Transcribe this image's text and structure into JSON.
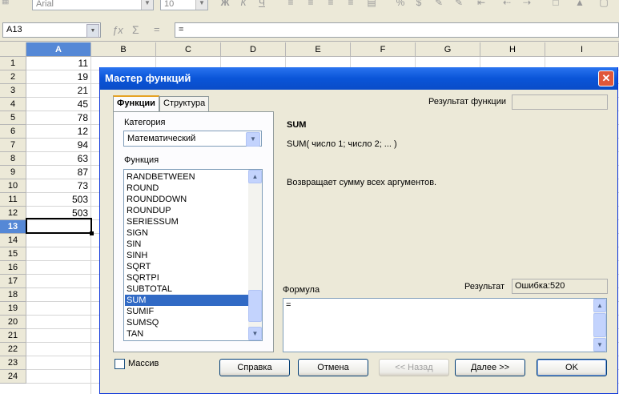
{
  "toolbar": {
    "font_name": "Arial",
    "font_size": "10",
    "icons": [
      "bold-icon",
      "italic-icon",
      "underline-icon",
      "align-left-icon",
      "align-center-icon",
      "align-right-icon",
      "justify-icon",
      "merge-icon",
      "percent-icon",
      "currency-icon",
      "decimal-add-icon",
      "decimal-remove-icon",
      "indent-decrease-icon",
      "indent-increase-icon",
      "borders-icon",
      "fill-color-icon",
      "font-color-icon"
    ]
  },
  "formula_bar": {
    "cell_ref": "A13",
    "content": "="
  },
  "sheet": {
    "columns": [
      "A",
      "B",
      "C",
      "D",
      "E",
      "F",
      "G",
      "H",
      "I"
    ],
    "rows": [
      "1",
      "2",
      "3",
      "4",
      "5",
      "6",
      "7",
      "8",
      "9",
      "10",
      "11",
      "12",
      "13",
      "14",
      "15",
      "16",
      "17",
      "18",
      "19",
      "20",
      "21",
      "22",
      "23",
      "24"
    ],
    "col_a_values": [
      "11",
      "19",
      "21",
      "45",
      "78",
      "12",
      "94",
      "63",
      "87",
      "73",
      "503",
      "503"
    ]
  },
  "dialog": {
    "title": "Мастер функций",
    "tabs": [
      "Функции",
      "Структура"
    ],
    "category_label": "Категория",
    "category_value": "Математический",
    "function_label": "Функция",
    "functions": [
      "RANDBETWEEN",
      "ROUND",
      "ROUNDDOWN",
      "ROUNDUP",
      "SERIESSUM",
      "SIGN",
      "SIN",
      "SINH",
      "SQRT",
      "SQRTPI",
      "SUBTOTAL",
      "SUM",
      "SUMIF",
      "SUMSQ",
      "TAN"
    ],
    "selected_function": "SUM",
    "function_result_label": "Результат функции",
    "function_result_value": "",
    "func_name": "SUM",
    "func_syntax": "SUM( число 1; число 2; ... )",
    "func_description": "Возвращает сумму всех аргументов.",
    "formula_label": "Формула",
    "formula_value": "=",
    "result_label": "Результат",
    "result_value": "Ошибка:520",
    "array_label": "Массив",
    "buttons": {
      "help": "Справка",
      "cancel": "Отмена",
      "back": "<< Назад",
      "next": "Далее >>",
      "ok": "OK"
    }
  }
}
